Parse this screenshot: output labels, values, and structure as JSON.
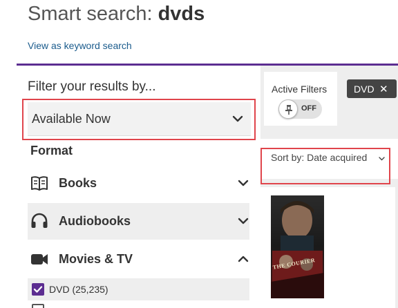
{
  "header": {
    "title_prefix": "Smart search: ",
    "query": "dvds",
    "keyword_link": "View as keyword search"
  },
  "sidebar": {
    "heading": "Filter your results by...",
    "available_now": "Available Now",
    "format_heading": "Format",
    "formats": [
      {
        "label": "Books",
        "icon": "book-icon",
        "expanded": false
      },
      {
        "label": "Audiobooks",
        "icon": "headphones-icon",
        "expanded": false
      },
      {
        "label": "Movies & TV",
        "icon": "video-camera-icon",
        "expanded": true
      }
    ],
    "format_options": [
      {
        "label": "DVD (25,235)",
        "checked": true
      }
    ]
  },
  "results": {
    "active_filters_label": "Active Filters",
    "toggle_state": "OFF",
    "filter_chips": [
      {
        "label": "DVD",
        "remove": "✕"
      }
    ],
    "sort_label": "Sort by: Date acquired",
    "cover_title": "THE COURIER"
  },
  "colors": {
    "accent": "#5c2d91",
    "highlight": "#e0444b",
    "chip": "#444444",
    "link": "#1a5b8c"
  }
}
